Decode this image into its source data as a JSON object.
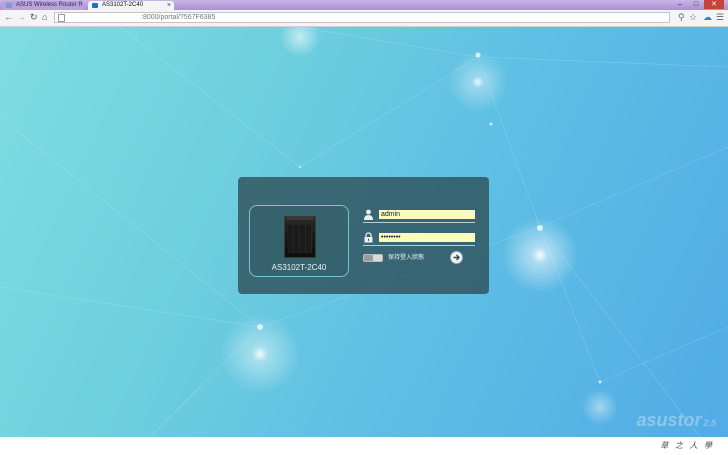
{
  "browser": {
    "tabs": [
      {
        "title": "ASUS Wireless Router R",
        "active": false
      },
      {
        "title": "AS3102T-2C40",
        "active": true
      }
    ],
    "tab_close_glyph": "×",
    "url": ":8000/portal/?567F6385",
    "window_controls": {
      "minimize": "–",
      "maximize": "□",
      "close": "✕"
    }
  },
  "login": {
    "device_name": "AS3102T-2C40",
    "username_value": "admin",
    "password_value": "••••••••",
    "remember_label": "保持登入狀態",
    "icons": {
      "user": "user-icon",
      "password": "lock-icon",
      "submit": "arrow-right-icon"
    }
  },
  "brand": {
    "name": "asustor",
    "version": "2.5"
  },
  "watermark": "草 之 人 學",
  "colors": {
    "accent": "#5fbfe4",
    "panel": "#2d4b55",
    "input_autofill": "#fbfbbd"
  }
}
